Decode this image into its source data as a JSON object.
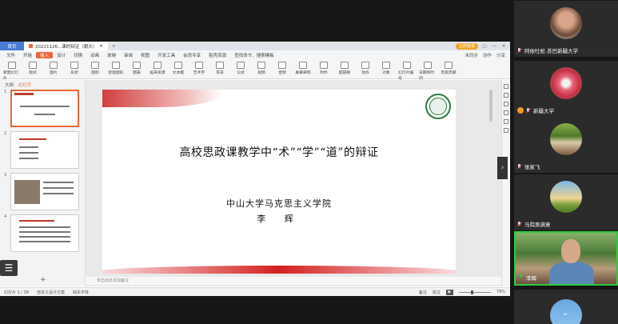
{
  "wps": {
    "tabs": {
      "home": "首页",
      "document": "20221126...课的辩证（朝大）",
      "add": "+"
    },
    "login_button": "立即登录",
    "window_controls": [
      "▢",
      "—",
      "✕"
    ],
    "menu": {
      "items": [
        "文件",
        "开始",
        "插入",
        "设计",
        "切换",
        "动画",
        "放映",
        "审阅",
        "视图",
        "开发工具",
        "会员专享",
        "稻壳资源"
      ],
      "search": "查找命令、搜索模板",
      "right": [
        "未同步",
        "协作",
        "分享"
      ]
    },
    "ribbon": [
      "新建幻灯片",
      "版式",
      "图片",
      "形状",
      "图标",
      "智能图形",
      "图表",
      "稻壳资源",
      "文本框",
      "艺术字",
      "符号",
      "公式",
      "视频",
      "音频",
      "屏幕录制",
      "附件",
      "超链接",
      "动作",
      "对象",
      "幻灯片编号",
      "日期和时间",
      "页眉页脚"
    ],
    "left_panel": {
      "tabs": [
        "大纲",
        "幻灯片"
      ],
      "slide_numbers": [
        "1",
        "2",
        "3",
        "4"
      ],
      "add": "+"
    },
    "slide": {
      "title": "高校思政课教学中“术”“学”“道”的辩证",
      "subtitle": "中山大学马克思主义学院",
      "author": "李 辉"
    },
    "notes_placeholder": "单击此处添加备注",
    "status": {
      "page": "幻灯片 1 / 38",
      "theme": "自定义设计方案",
      "missing_font": "缺失字体",
      "notes": "备注",
      "comments": "批注",
      "zoom": "79%",
      "zoom_level": 0.79
    }
  },
  "chat_icon": "☰",
  "collapse_icon": "›",
  "participants": [
    {
      "name": "阿依吐松·苏巴新疆大学",
      "mic": "muted"
    },
    {
      "name": "新疆大学",
      "mic": "muted"
    },
    {
      "name": "张家飞",
      "mic": "muted"
    },
    {
      "name": "马院吴满意",
      "mic": "muted"
    },
    {
      "name": "李辉",
      "mic": "active"
    }
  ]
}
